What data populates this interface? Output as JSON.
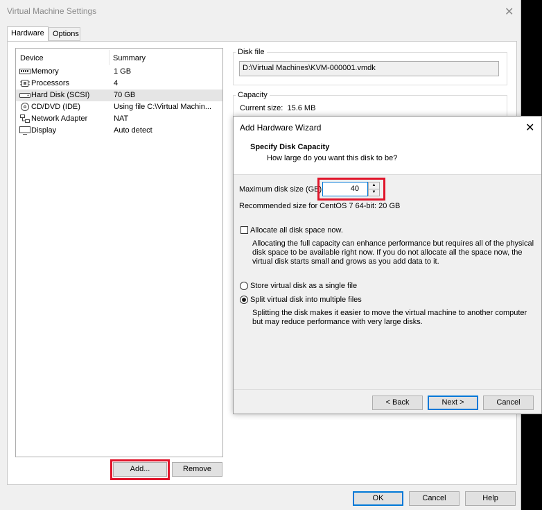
{
  "window": {
    "title": "Virtual Machine Settings",
    "close_glyph": "✕",
    "tabs": [
      {
        "label": "Hardware",
        "active": true
      },
      {
        "label": "Options",
        "active": false
      }
    ]
  },
  "device_list": {
    "columns": [
      "Device",
      "Summary"
    ],
    "rows": [
      {
        "icon": "memory-icon",
        "device": "Memory",
        "summary": "1 GB",
        "selected": false
      },
      {
        "icon": "processor-icon",
        "device": "Processors",
        "summary": "4",
        "selected": false
      },
      {
        "icon": "hard-disk-icon",
        "device": "Hard Disk (SCSI)",
        "summary": "70 GB",
        "selected": true
      },
      {
        "icon": "cd-dvd-icon",
        "device": "CD/DVD (IDE)",
        "summary": "Using file C:\\Virtual Machin...",
        "selected": false
      },
      {
        "icon": "network-adapter-icon",
        "device": "Network Adapter",
        "summary": "NAT",
        "selected": false
      },
      {
        "icon": "display-icon",
        "device": "Display",
        "summary": "Auto detect",
        "selected": false
      }
    ],
    "add_button": "Add...",
    "remove_button": "Remove"
  },
  "disk_file": {
    "group_label": "Disk file",
    "path": "D:\\Virtual Machines\\KVM-000001.vmdk"
  },
  "capacity": {
    "group_label": "Capacity",
    "current_size": "Current size:  15.6 MB"
  },
  "footer": {
    "ok": "OK",
    "cancel": "Cancel",
    "help": "Help"
  },
  "wizard": {
    "title": "Add Hardware Wizard",
    "close_glyph": "✕",
    "heading": "Specify Disk Capacity",
    "subheading": "How large do you want this disk to be?",
    "max_size_label": "Maximum disk size (GB):",
    "max_size_value": "40",
    "recommended": "Recommended size for CentOS 7 64-bit: 20 GB",
    "allocate_label": "Allocate all disk space now.",
    "allocate_checked": false,
    "allocate_desc": [
      "Allocating the full capacity can enhance performance but requires all of the physical",
      "disk space to be available right now. If you do not allocate all the space now, the",
      "virtual disk starts small and grows as you add data to it."
    ],
    "single_file_label": "Store virtual disk as a single file",
    "multi_file_label": "Split virtual disk into multiple files",
    "selected_storage": "multiple",
    "split_desc": [
      "Splitting the disk makes it easier to move the virtual machine to another computer",
      "but may reduce performance with very large disks."
    ],
    "back_button": "< Back",
    "next_button": "Next >",
    "cancel_button": "Cancel"
  },
  "colors": {
    "highlight_box": "#e0142a",
    "focus_blue": "#0078d7",
    "dialog_bg": "#f0f0f0"
  }
}
